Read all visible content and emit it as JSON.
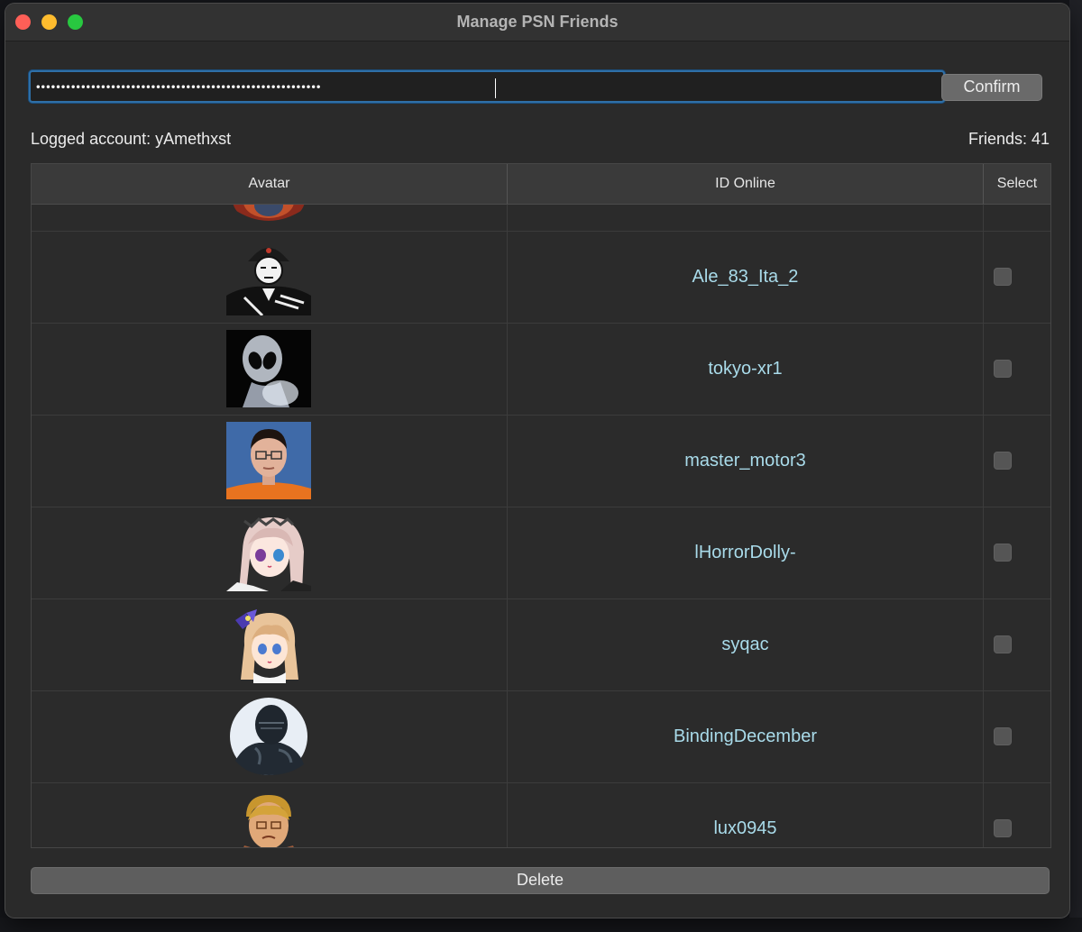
{
  "window": {
    "title": "Manage PSN Friends"
  },
  "login": {
    "password_value": "•••••••••••••••••••••••••••••••••••••••••••••••••••••••••",
    "confirm_label": "Confirm"
  },
  "status": {
    "account_label": "Logged account: yAmethxst",
    "friends_label": "Friends: 41"
  },
  "table": {
    "columns": [
      "Avatar",
      "ID Online",
      "Select"
    ],
    "rows": [
      {
        "id": "",
        "avatar": "partial-helmet-avatar",
        "checked": false
      },
      {
        "id": "Ale_83_Ita_2",
        "avatar": "soldier-avatar",
        "checked": false
      },
      {
        "id": "tokyo-xr1",
        "avatar": "alien-avatar",
        "checked": false
      },
      {
        "id": "master_motor3",
        "avatar": "man-photo-avatar",
        "checked": false
      },
      {
        "id": "lHorrorDolly-",
        "avatar": "anime-girl-avatar",
        "checked": false
      },
      {
        "id": "syqac",
        "avatar": "anime-girl-bow-avatar",
        "checked": false
      },
      {
        "id": "BindingDecember",
        "avatar": "knight-avatar",
        "checked": false
      },
      {
        "id": "lux0945",
        "avatar": "old-man-avatar",
        "checked": false
      }
    ]
  },
  "actions": {
    "delete_label": "Delete"
  },
  "colors": {
    "accent": "#2f6fa6",
    "friend_id_text": "#a9dbea",
    "window_bg": "#2a2a2a"
  }
}
